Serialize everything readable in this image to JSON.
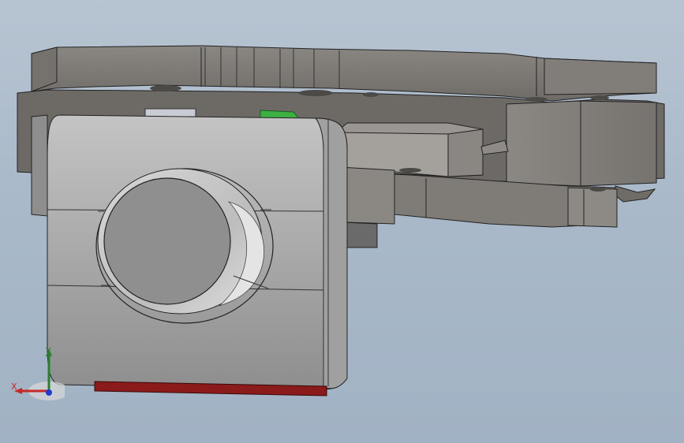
{
  "viewport": {
    "background_top": "#b7c4d2",
    "background_bottom": "#a1b2c4"
  },
  "model": {
    "colors": {
      "body_light": "#b9b9b9",
      "body_mid": "#9d9d9d",
      "body_dark": "#7d7b77",
      "plate": "#86837e",
      "plate_dark": "#6e6b67",
      "green_part": "#3cb043",
      "red_part": "#8b1a1a",
      "edge": "#222222"
    }
  },
  "triad": {
    "x_label": "X",
    "y_label": "Y",
    "x_color": "#c62828",
    "y_color": "#2e7d32",
    "z_color": "#1e3cc8"
  }
}
